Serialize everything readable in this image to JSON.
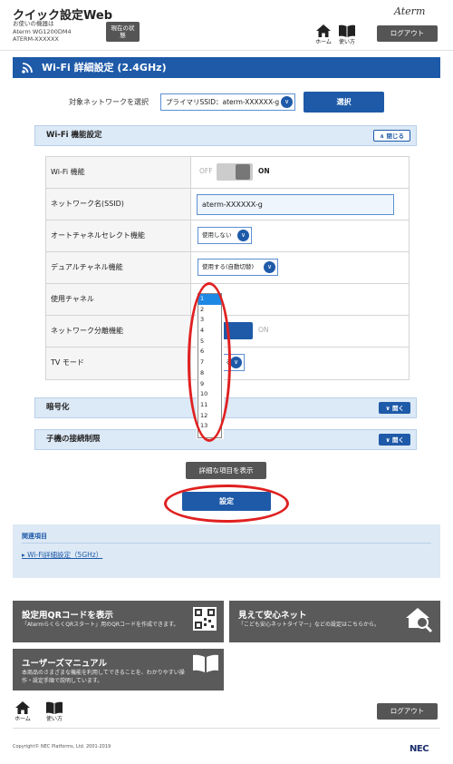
{
  "header": {
    "app_title": "クイック設定Web",
    "device_label": "お使いの機器は",
    "device_model": "Aterm WG1200DM4",
    "device_name": "ATERM-XXXXXX",
    "status_button": "現在の状態",
    "home_label": "ホーム",
    "usage_label": "使い方",
    "brand": "Aterm",
    "logout": "ログアウト"
  },
  "page": {
    "title": "Wi-Fi 詳細設定 (2.4GHz)",
    "network_select_label": "対象ネットワークを選択",
    "network_select_value": "プライマリSSID：aterm-XXXXXX-g",
    "select_button": "選択"
  },
  "sections": {
    "wifi_function": {
      "title": "Wi-Fi 機能設定",
      "toggle": "閉じる"
    },
    "encryption": {
      "title": "暗号化",
      "toggle": "開く"
    },
    "client_limit": {
      "title": "子機の接続制限",
      "toggle": "開く"
    }
  },
  "settings": {
    "wifi_label": "Wi-Fi 機能",
    "wifi_off": "OFF",
    "wifi_on": "ON",
    "ssid_label": "ネットワーク名(SSID)",
    "ssid_value": "aterm-XXXXXX-g",
    "auto_channel_label": "オートチャネルセレクト機能",
    "auto_channel_value": "使用しない",
    "dual_channel_label": "デュアルチャネル機能",
    "dual_channel_value": "使用する(自動切替)",
    "channel_label": "使用チャネル",
    "isolation_label": "ネットワーク分離機能",
    "isolation_on": "ON",
    "tv_mode_label": "TV モード",
    "tv_mode_value": "る"
  },
  "channel_dropdown": {
    "options": [
      "1",
      "2",
      "3",
      "4",
      "5",
      "6",
      "7",
      "8",
      "9",
      "10",
      "11",
      "12",
      "13"
    ],
    "selected": "1"
  },
  "buttons": {
    "show_details": "詳細な項目を表示",
    "apply": "設定"
  },
  "related": {
    "title": "関連項目",
    "link": "Wi-Fi詳細設定（5GHz）"
  },
  "cards": {
    "qr_title": "設定用QRコードを表示",
    "qr_desc": "「AtermらくらくQRスタート」用のQRコードを作成できます。",
    "safe_title": "見えて安心ネット",
    "safe_desc": "「こども安心ネットタイマー」などの設定はこちらから。",
    "manual_title": "ユーザーズマニュアル",
    "manual_desc_1": "本商品のさまざまな機能を利用してできることを、わかりやすい操",
    "manual_desc_2": "作・設定手順で説明しています。"
  },
  "footer": {
    "home_label": "ホーム",
    "usage_label": "使い方",
    "logout": "ログアウト",
    "copyright": "Copyright© NEC Platforms, Ltd. 2001-2019",
    "brand": "NEC"
  },
  "colors": {
    "accent": "#1e5aa8",
    "section_bg": "#dce9f6",
    "highlight_red": "#e02020"
  }
}
